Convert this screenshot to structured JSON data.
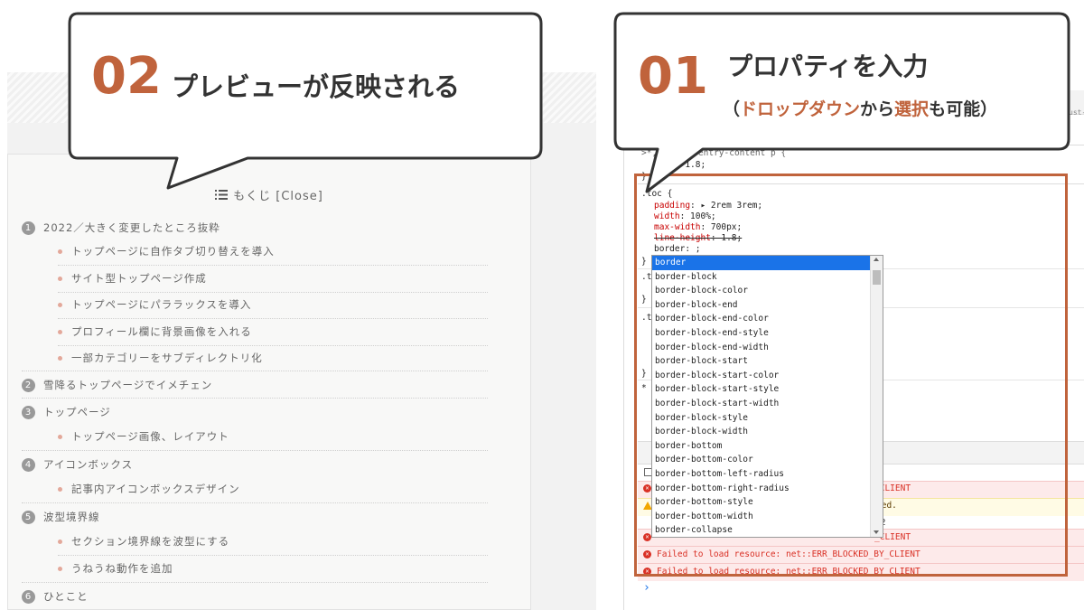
{
  "callout_left": {
    "number": "02",
    "text": "プレビューが反映される"
  },
  "callout_right": {
    "number": "01",
    "text": "プロパティを入力",
    "sub_open": "（",
    "sub_highlight_1": "ドロップダウン",
    "sub_mid": "から",
    "sub_highlight_2": "選択",
    "sub_close": "も可能）"
  },
  "colors": {
    "accent": "#c0633c",
    "dark": "#333333",
    "select_blue": "#1a73e8"
  },
  "toc": {
    "icon": "list-icon",
    "title": "もくじ [Close]",
    "sections": [
      {
        "num": "1",
        "label": "2022／大きく変更したところ抜粋",
        "subs": [
          "トップページに自作タブ切り替えを導入",
          "サイト型トップページ作成",
          "トップページにパララックスを導入",
          "プロフィール欄に背景画像を入れる",
          "一部カテゴリーをサブディレクトリ化"
        ]
      },
      {
        "num": "2",
        "label": "雪降るトップページでイメチェン",
        "subs": []
      },
      {
        "num": "3",
        "label": "トップページ",
        "subs": [
          "トップページ画像、レイアウト"
        ]
      },
      {
        "num": "4",
        "label": "アイコンボックス",
        "subs": [
          "記事内アイコンボックスデザイン"
        ]
      },
      {
        "num": "5",
        "label": "波型境界線",
        "subs": [
          "セクション境界線を波型にする",
          "うねうね動作を追加"
        ]
      },
      {
        "num": "6",
        "label": "ひとこと",
        "subs": []
      }
    ]
  },
  "devtools": {
    "top_fragment": "ust-",
    "code_line1": ">*, .demo .entry-content p {",
    "code_line2_prop": "ight",
    "code_line2_val": ": 1.8;",
    "selector": ".toc {",
    "decls": [
      {
        "prop": "padding",
        "val": ": ▸ 2rem 3rem;"
      },
      {
        "prop": "width",
        "val": ": 100%;"
      },
      {
        "prop": "max-width",
        "val": ": 700px;"
      },
      {
        "prop": "line-height",
        "val": ": 1.8;"
      }
    ],
    "editing": "border: ;",
    "close_brace": "}",
    "frag_t1": ".t",
    "frag_t2": ".t",
    "frag_star": "*",
    "dropdown": [
      "border",
      "border-block",
      "border-block-color",
      "border-block-end",
      "border-block-end-color",
      "border-block-end-style",
      "border-block-end-width",
      "border-block-start",
      "border-block-start-color",
      "border-block-start-style",
      "border-block-start-width",
      "border-block-style",
      "border-block-width",
      "border-bottom",
      "border-bottom-color",
      "border-bottom-left-radius",
      "border-bottom-right-radius",
      "border-bottom-style",
      "border-bottom-width",
      "border-collapse"
    ],
    "console": {
      "err_tail_1": "_CLIENT",
      "warn_tail": "ted.",
      "info_tail": ".2",
      "err_tail_2": "_CLIENT",
      "err_full": "Failed to load resource: net::ERR_BLOCKED_BY_CLIENT",
      "prompt": "›"
    }
  }
}
